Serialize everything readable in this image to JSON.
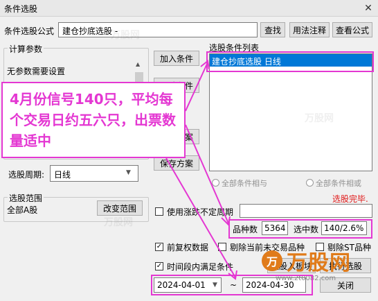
{
  "window": {
    "title": "条件选股"
  },
  "formula": {
    "label": "条件选股公式",
    "value": "建仓抄底选股  -",
    "buttons": {
      "find": "查找",
      "usage": "用法注释",
      "view": "查看公式"
    }
  },
  "params": {
    "legend": "计算参数",
    "text": "无参数需要设置"
  },
  "actions": {
    "add": "加入条件",
    "delete": "删除条件",
    "import": "引入方案",
    "save": "保存方案"
  },
  "condition_list": {
    "label": "选股条件列表",
    "items": [
      "建仓抄底选股  日线"
    ]
  },
  "period": {
    "label": "选股周期:",
    "value": "日线"
  },
  "logic": {
    "and_label": "全部条件相与",
    "or_label": "全部条件相或"
  },
  "status": {
    "done": "选股完毕."
  },
  "range": {
    "legend": "选股范围",
    "value": "全部A股",
    "change_btn": "改变范围"
  },
  "options": {
    "limit_period": "使用涨跌不定周期",
    "pre_adjust": "前复权数据",
    "exclude_untraded": "剔除当前未交易品种",
    "exclude_st": "剔除ST品种",
    "time_range": "时间段内满足条件"
  },
  "stats": {
    "count_label": "品种数",
    "count_value": "5364",
    "selected_label": "选中数",
    "selected_value": "140/2.6%"
  },
  "dates": {
    "start": "2024-04-01",
    "end": "2024-04-30"
  },
  "bottom_buttons": {
    "to_block": "选股入板块",
    "run": "执行选股",
    "close": "关闭"
  },
  "annotation": {
    "text": "4月份信号140只，平均每个交易日约五六只，出票数量适中"
  },
  "watermark": {
    "text": "万股网",
    "url": "www.2t0082.com"
  },
  "colors": {
    "accent": "#e437d2",
    "selection": "#0078d7",
    "status_red": "#e01818"
  }
}
